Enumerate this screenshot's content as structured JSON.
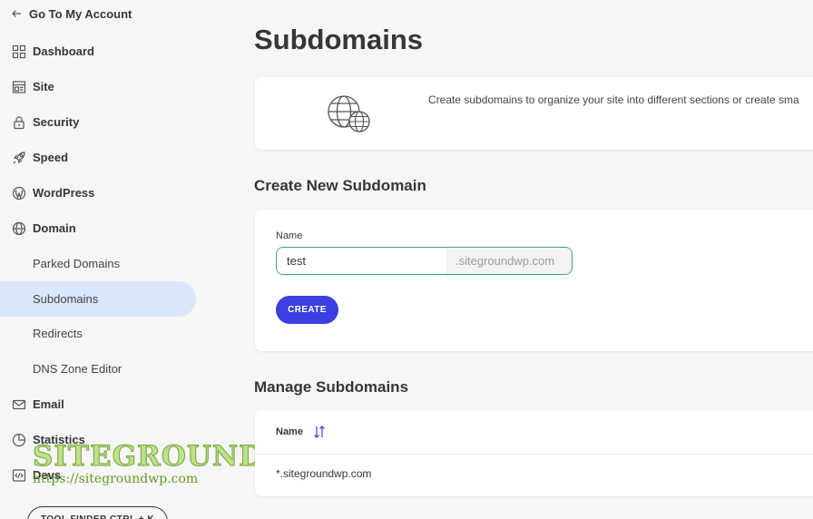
{
  "sidebar": {
    "back_label": "Go To My Account",
    "items": [
      {
        "label": "Dashboard",
        "icon": "dashboard-icon"
      },
      {
        "label": "Site",
        "icon": "site-icon"
      },
      {
        "label": "Security",
        "icon": "lock-icon"
      },
      {
        "label": "Speed",
        "icon": "rocket-icon"
      },
      {
        "label": "WordPress",
        "icon": "wordpress-icon"
      },
      {
        "label": "Domain",
        "icon": "globe-icon"
      }
    ],
    "domain_subitems": [
      "Parked Domains",
      "Subdomains",
      "Redirects",
      "DNS Zone Editor"
    ],
    "active_subitem": "Subdomains",
    "items_after": [
      {
        "label": "Email",
        "icon": "email-icon"
      },
      {
        "label": "Statistics",
        "icon": "statistics-icon"
      },
      {
        "label": "Devs",
        "icon": "code-icon"
      }
    ],
    "tool_finder_label": "TOOL FINDER CTRL + K"
  },
  "watermark": {
    "title": "SITEGROUND WP",
    "url": "https://sitegroundwp.com"
  },
  "main": {
    "page_title": "Subdomains",
    "intro_text": "Create subdomains to organize your site into different sections or create sma",
    "create_section": {
      "title": "Create New Subdomain",
      "name_label": "Name",
      "name_value": "test",
      "domain_suffix": ".sitegroundwp.com",
      "create_button": "CREATE"
    },
    "manage_section": {
      "title": "Manage Subdomains",
      "column_name": "Name",
      "rows": [
        "*.sitegroundwp.com"
      ]
    }
  },
  "colors": {
    "accent": "#3d3fe0",
    "active_nav_bg": "#dbe7fa",
    "input_border": "#3aa869",
    "background": "#f6f6f6"
  }
}
